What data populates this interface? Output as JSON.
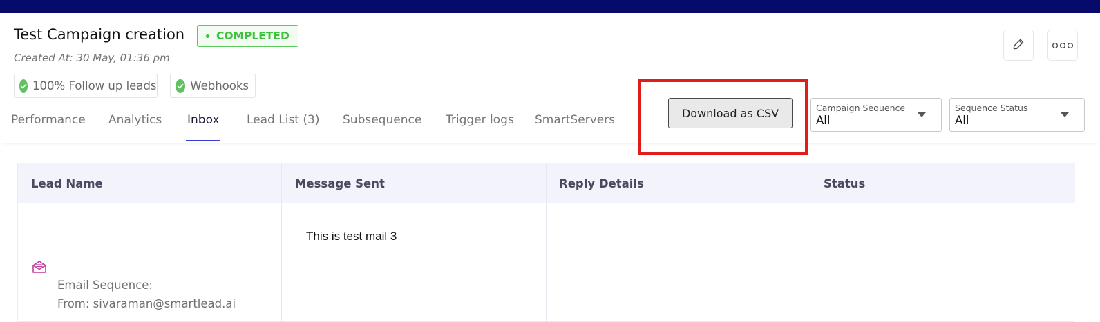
{
  "campaign": {
    "title": "Test Campaign creation",
    "status": "COMPLETED",
    "created_at": "Created At: 30 May, 01:36 pm"
  },
  "chips": [
    {
      "label": "100% Follow up leads",
      "icon": "check-circle-icon"
    },
    {
      "label": "Webhooks",
      "icon": "check-circle-icon"
    }
  ],
  "actions": {
    "edit_icon": "pencil-icon",
    "more_icon": "more-horizontal-icon"
  },
  "tabs": [
    {
      "label": "Performance"
    },
    {
      "label": "Analytics"
    },
    {
      "label": "Inbox",
      "active": true
    },
    {
      "label": "Lead List (3)"
    },
    {
      "label": "Subsequence"
    },
    {
      "label": "Trigger logs"
    },
    {
      "label": "SmartServers"
    }
  ],
  "toolbar": {
    "download_label": "Download as CSV",
    "campaign_sequence": {
      "label": "Campaign Sequence",
      "value": "All"
    },
    "sequence_status": {
      "label": "Sequence Status",
      "value": "All"
    }
  },
  "table": {
    "columns": [
      "Lead Name",
      "Message Sent",
      "Reply Details",
      "Status"
    ],
    "rows": [
      {
        "message": "This is test mail 3",
        "sequence": "Email Sequence:",
        "from": "From: sivaraman@smartlead.ai",
        "icon": "mail-open-icon"
      }
    ]
  },
  "colors": {
    "top_bar": "#050a6b",
    "status_green": "#3ec23e",
    "highlight_red": "#e21b1b",
    "active_tab": "#3a3fd6",
    "mail_icon": "#c2379a"
  }
}
